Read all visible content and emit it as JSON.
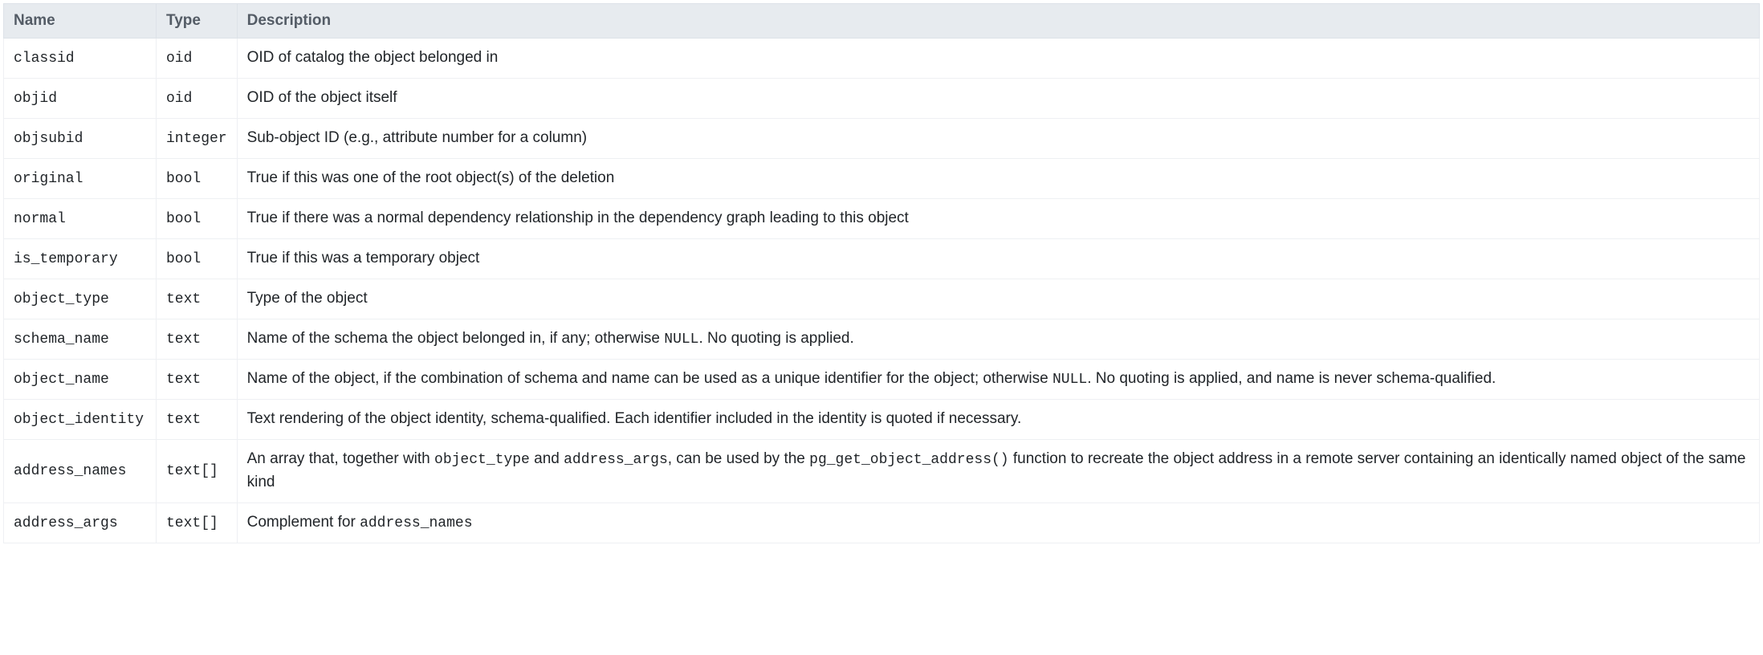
{
  "table": {
    "headers": {
      "name": "Name",
      "type": "Type",
      "description": "Description"
    },
    "rows": [
      {
        "name": "classid",
        "type": "oid",
        "desc_parts": [
          {
            "text": "OID of catalog the object belonged in",
            "code": false
          }
        ]
      },
      {
        "name": "objid",
        "type": "oid",
        "desc_parts": [
          {
            "text": "OID of the object itself",
            "code": false
          }
        ]
      },
      {
        "name": "objsubid",
        "type": "integer",
        "desc_parts": [
          {
            "text": "Sub-object ID (e.g., attribute number for a column)",
            "code": false
          }
        ]
      },
      {
        "name": "original",
        "type": "bool",
        "desc_parts": [
          {
            "text": "True if this was one of the root object(s) of the deletion",
            "code": false
          }
        ]
      },
      {
        "name": "normal",
        "type": "bool",
        "desc_parts": [
          {
            "text": "True if there was a normal dependency relationship in the dependency graph leading to this object",
            "code": false
          }
        ]
      },
      {
        "name": "is_temporary",
        "type": "bool",
        "desc_parts": [
          {
            "text": "True if this was a temporary object",
            "code": false
          }
        ]
      },
      {
        "name": "object_type",
        "type": "text",
        "desc_parts": [
          {
            "text": "Type of the object",
            "code": false
          }
        ]
      },
      {
        "name": "schema_name",
        "type": "text",
        "desc_parts": [
          {
            "text": "Name of the schema the object belonged in, if any; otherwise ",
            "code": false
          },
          {
            "text": "NULL",
            "code": true
          },
          {
            "text": ". No quoting is applied.",
            "code": false
          }
        ]
      },
      {
        "name": "object_name",
        "type": "text",
        "desc_parts": [
          {
            "text": "Name of the object, if the combination of schema and name can be used as a unique identifier for the object; otherwise ",
            "code": false
          },
          {
            "text": "NULL",
            "code": true
          },
          {
            "text": ". No quoting is applied, and name is never schema-qualified.",
            "code": false
          }
        ]
      },
      {
        "name": "object_identity",
        "type": "text",
        "desc_parts": [
          {
            "text": "Text rendering of the object identity, schema-qualified. Each identifier included in the identity is quoted if necessary.",
            "code": false
          }
        ]
      },
      {
        "name": "address_names",
        "type": "text[]",
        "desc_parts": [
          {
            "text": "An array that, together with ",
            "code": false
          },
          {
            "text": "object_type",
            "code": true
          },
          {
            "text": " and ",
            "code": false
          },
          {
            "text": "address_args",
            "code": true
          },
          {
            "text": ", can be used by the ",
            "code": false
          },
          {
            "text": "pg_get_object_address()",
            "code": true
          },
          {
            "text": " function to recreate the object address in a remote server containing an identically named object of the same kind",
            "code": false
          }
        ]
      },
      {
        "name": "address_args",
        "type": "text[]",
        "desc_parts": [
          {
            "text": "Complement for ",
            "code": false
          },
          {
            "text": "address_names",
            "code": true
          }
        ]
      }
    ]
  }
}
